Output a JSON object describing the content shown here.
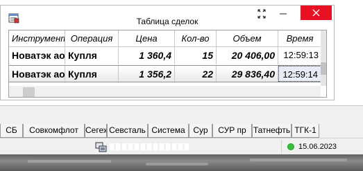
{
  "window": {
    "title": "Таблица сделок"
  },
  "table": {
    "columns": [
      "Инструмент",
      "Операция",
      "Цена",
      "Кол-во",
      "Объем",
      "Время"
    ],
    "rows": [
      [
        "Новатэк ао",
        "Купля",
        "1 360,4",
        "15",
        "20 406,00",
        "12:59:13"
      ],
      [
        "Новатэк ао",
        "Купля",
        "1 356,2",
        "22",
        "29 836,40",
        "12:59:14"
      ]
    ]
  },
  "tabs": [
    "СБ",
    "Совкомфлот",
    "Сегежа",
    "Севсталь",
    "Система",
    "Сур",
    "СУР пр",
    "Татнефть",
    "ТГК-1"
  ],
  "status": {
    "date": "15.06.2023"
  },
  "colors": {
    "close_button": "#e81123",
    "status_ok": "#33c23a",
    "selection": "#e8ecf6"
  }
}
